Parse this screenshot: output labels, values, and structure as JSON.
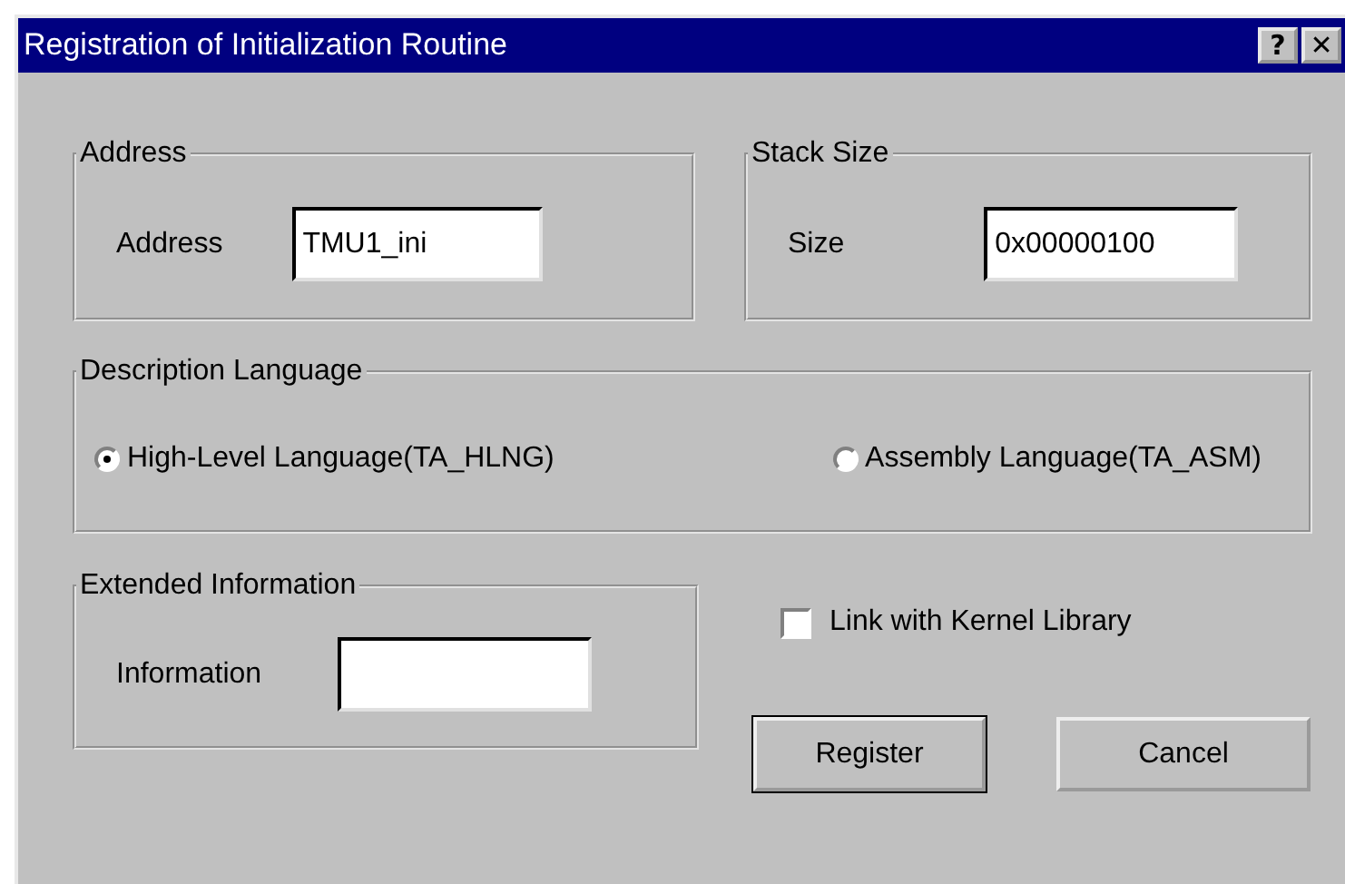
{
  "window": {
    "title": "Registration of Initialization Routine",
    "title_buttons": [
      "?",
      "✕"
    ]
  },
  "address_group": {
    "title": "Address",
    "label": "Address",
    "value": "TMU1_ini"
  },
  "stack_group": {
    "title": "Stack Size",
    "label": "Size",
    "value": "0x00000100"
  },
  "language_group": {
    "title": "Description Language",
    "options": [
      {
        "label": "High-Level Language(TA_HLNG)",
        "selected": true
      },
      {
        "label": "Assembly Language(TA_ASM)",
        "selected": false
      }
    ]
  },
  "extended_group": {
    "title": "Extended Information",
    "label": "Information"
  },
  "link_checkbox": {
    "label": "Link with Kernel Library",
    "checked": false
  },
  "buttons": [
    {
      "label": "Register",
      "default": true
    },
    {
      "label": "Cancel",
      "default": false
    }
  ]
}
